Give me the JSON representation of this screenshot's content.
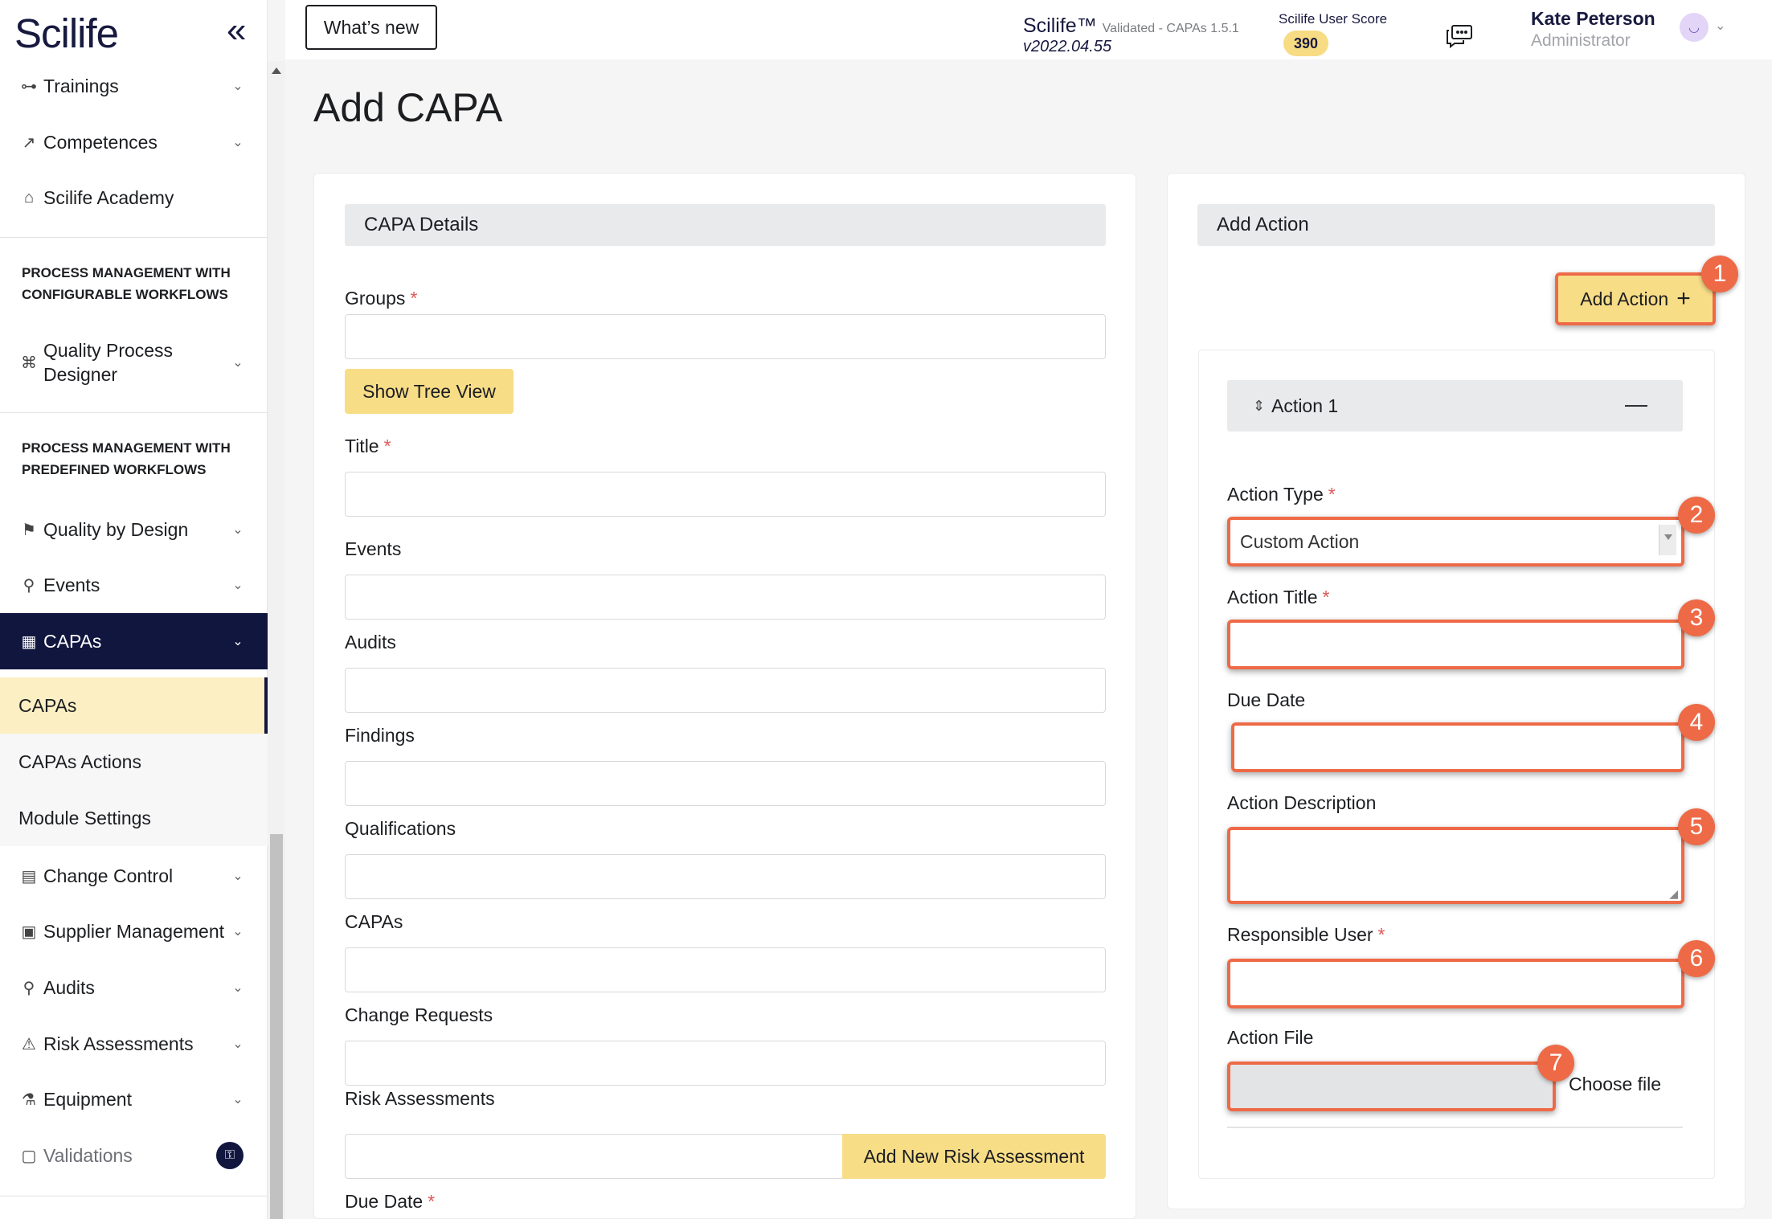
{
  "app": {
    "logo": "Scilife"
  },
  "sidebar": {
    "items_top": [
      {
        "label": "Trainings",
        "icon": "dumbbell-icon"
      },
      {
        "label": "Competences",
        "icon": "growth-chart-icon"
      },
      {
        "label": "Scilife Academy",
        "icon": "graduation-cap-icon"
      }
    ],
    "section_configurable": "PROCESS MANAGEMENT WITH CONFIGURABLE WORKFLOWS",
    "quality_process_designer": "Quality Process Designer",
    "section_predefined": "PROCESS MANAGEMENT WITH PREDEFINED WORKFLOWS",
    "quality_by_design": "Quality by Design",
    "events": "Events",
    "capas": "CAPAs",
    "sub_items": [
      "CAPAs",
      "CAPAs Actions",
      "Module Settings"
    ],
    "items_bottom": [
      {
        "label": "Change Control",
        "icon": "document-stack-icon"
      },
      {
        "label": "Supplier Management",
        "icon": "box-icon"
      },
      {
        "label": "Audits",
        "icon": "magnifier-doc-icon"
      },
      {
        "label": "Risk Assessments",
        "icon": "warning-triangle-icon"
      },
      {
        "label": "Equipment",
        "icon": "flask-icon"
      }
    ],
    "validations": "Validations"
  },
  "topbar": {
    "whats_new": "What’s new",
    "product": "Scilife™",
    "validated": "Validated - CAPAs 1.5.1",
    "version": "v2022.04.55",
    "score_label": "Scilife User Score",
    "score_value": "390",
    "user_name": "Kate Peterson",
    "user_role": "Administrator"
  },
  "page": {
    "title": "Add CAPA"
  },
  "capa_details": {
    "heading": "CAPA Details",
    "groups": "Groups",
    "show_tree_view": "Show Tree View",
    "title": "Title",
    "events": "Events",
    "audits": "Audits",
    "findings": "Findings",
    "qualifications": "Qualifications",
    "capas": "CAPAs",
    "change_requests": "Change Requests",
    "risk_assessments": "Risk Assessments",
    "add_new_risk_assessment": "Add New Risk Assessment",
    "due_date": "Due Date",
    "required_mark": "*"
  },
  "add_action": {
    "heading": "Add Action",
    "button": "Add Action",
    "action_header": "Action 1",
    "action_type_label": "Action Type",
    "action_type_value": "Custom Action",
    "action_title_label": "Action Title",
    "due_date_label": "Due Date",
    "description_label": "Action Description",
    "responsible_label": "Responsible User",
    "file_label": "Action File",
    "choose_file": "Choose file",
    "markers": [
      "1",
      "2",
      "3",
      "4",
      "5",
      "6",
      "7"
    ]
  },
  "colors": {
    "navy": "#11163f",
    "accent_yellow": "#f8dd87",
    "highlight_orange": "#ee6a47",
    "selected_bg": "#fcefc3"
  }
}
